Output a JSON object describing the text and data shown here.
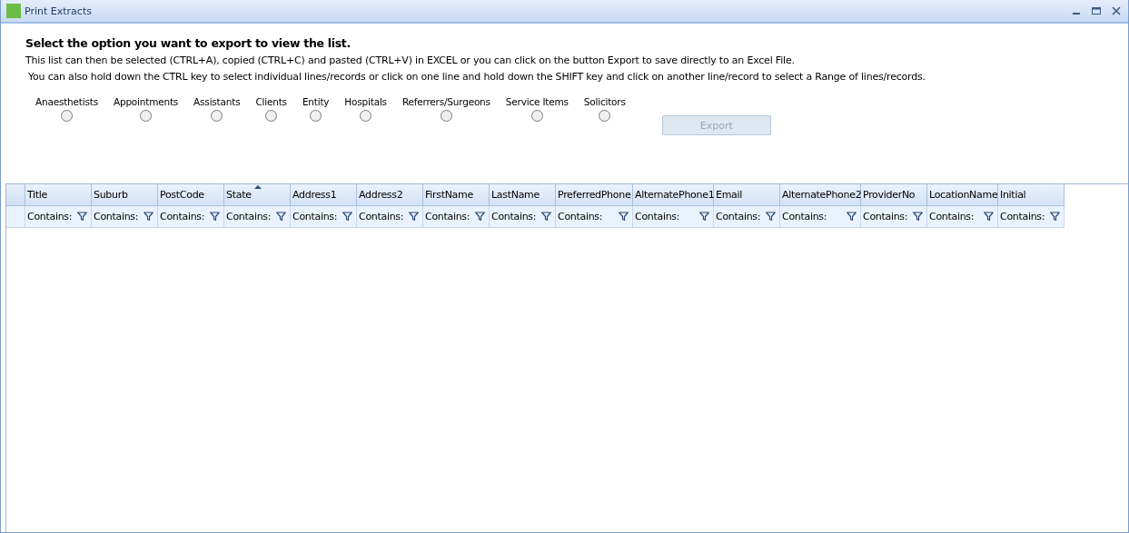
{
  "window": {
    "title": "Print Extracts"
  },
  "heading": "Select the option you want to export to view the list.",
  "instructions": [
    "This list can then be selected (CTRL+A), copied (CTRL+C) and pasted (CTRL+V) in EXCEL or you can click on the button Export to save directly to an Excel File.",
    "You can also hold down the CTRL key to select individual lines/records or click on one line and hold down the SHIFT key and click on another line/record to select a Range of lines/records."
  ],
  "options": [
    {
      "label": "Anaesthetists",
      "selected": false
    },
    {
      "label": "Appointments",
      "selected": false
    },
    {
      "label": "Assistants",
      "selected": false
    },
    {
      "label": "Clients",
      "selected": false
    },
    {
      "label": "Entity",
      "selected": false
    },
    {
      "label": "Hospitals",
      "selected": false
    },
    {
      "label": "Referrers/Surgeons",
      "selected": false
    },
    {
      "label": "Service Items",
      "selected": false
    },
    {
      "label": "Solicitors",
      "selected": false
    }
  ],
  "export_button": {
    "label": "Export",
    "disabled": true
  },
  "table": {
    "columns": [
      {
        "label": "Title",
        "filter": "Contains:",
        "sorted": false
      },
      {
        "label": "Suburb",
        "filter": "Contains:",
        "sorted": false
      },
      {
        "label": "PostCode",
        "filter": "Contains:",
        "sorted": false
      },
      {
        "label": "State",
        "filter": "Contains:",
        "sorted": true
      },
      {
        "label": "Address1",
        "filter": "Contains:",
        "sorted": false
      },
      {
        "label": "Address2",
        "filter": "Contains:",
        "sorted": false
      },
      {
        "label": "FirstName",
        "filter": "Contains:",
        "sorted": false
      },
      {
        "label": "LastName",
        "filter": "Contains:",
        "sorted": false
      },
      {
        "label": "PreferredPhone",
        "filter": "Contains:",
        "sorted": false
      },
      {
        "label": "AlternatePhone1",
        "filter": "Contains:",
        "sorted": false
      },
      {
        "label": "Email",
        "filter": "Contains:",
        "sorted": false
      },
      {
        "label": "AlternatePhone2",
        "filter": "Contains:",
        "sorted": false
      },
      {
        "label": "ProviderNo",
        "filter": "Contains:",
        "sorted": false
      },
      {
        "label": "LocationName",
        "filter": "Contains:",
        "sorted": false
      },
      {
        "label": "Initial",
        "filter": "Contains:",
        "sorted": false
      }
    ]
  }
}
